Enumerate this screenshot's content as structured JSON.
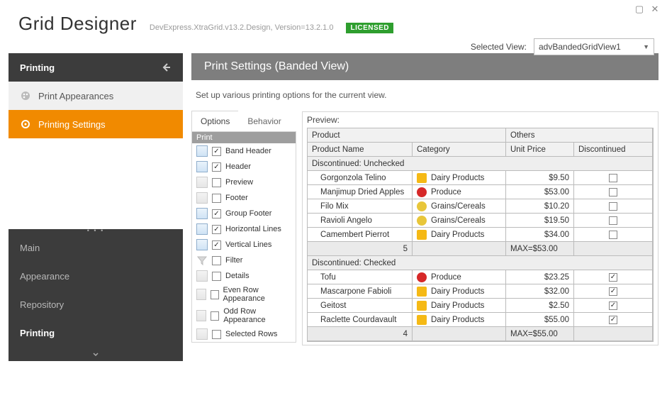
{
  "window": {
    "title": "Grid Designer",
    "assembly": "DevExpress.XtraGrid.v13.2.Design, Version=13.2.1.0",
    "license": "LICENSED"
  },
  "selected_view": {
    "label": "Selected View:",
    "value": "advBandedGridView1"
  },
  "sidebar": {
    "section": "Printing",
    "items": [
      {
        "label": "Print Appearances"
      },
      {
        "label": "Printing Settings"
      }
    ],
    "nav": [
      "Main",
      "Appearance",
      "Repository",
      "Printing"
    ],
    "active_nav": "Printing"
  },
  "panel": {
    "title": "Print Settings (Banded View)",
    "desc": "Set up various printing options for the current view."
  },
  "tabs": {
    "options": "Options",
    "behavior": "Behavior"
  },
  "options": {
    "group": "Print",
    "items": [
      {
        "label": "Band Header",
        "checked": true,
        "iconGray": false
      },
      {
        "label": "Header",
        "checked": true,
        "iconGray": false
      },
      {
        "label": "Preview",
        "checked": false,
        "iconGray": true
      },
      {
        "label": "Footer",
        "checked": false,
        "iconGray": true
      },
      {
        "label": "Group Footer",
        "checked": true,
        "iconGray": false
      },
      {
        "label": "Horizontal Lines",
        "checked": true,
        "iconGray": false
      },
      {
        "label": "Vertical Lines",
        "checked": true,
        "iconGray": false
      },
      {
        "label": "Filter",
        "checked": false,
        "iconGray": true,
        "funnel": true
      },
      {
        "label": "Details",
        "checked": false,
        "iconGray": true
      },
      {
        "label": "Even Row Appearance",
        "checked": false,
        "iconGray": true
      },
      {
        "label": "Odd Row Appearance",
        "checked": false,
        "iconGray": true
      },
      {
        "label": "Selected Rows",
        "checked": false,
        "iconGray": true
      }
    ]
  },
  "preview": {
    "label": "Preview:",
    "bands": {
      "product": "Product",
      "others": "Others"
    },
    "columns": {
      "name": "Product Name",
      "category": "Category",
      "price": "Unit Price",
      "disc": "Discontinued"
    },
    "groups": [
      {
        "title": "Discontinued: Unchecked",
        "rows": [
          {
            "name": "Gorgonzola Telino",
            "category": "Dairy Products",
            "catType": "dairy",
            "price": "$9.50",
            "disc": false
          },
          {
            "name": "Manjimup Dried Apples",
            "category": "Produce",
            "catType": "prod",
            "price": "$53.00",
            "disc": false
          },
          {
            "name": "Filo Mix",
            "category": "Grains/Cereals",
            "catType": "grain",
            "price": "$10.20",
            "disc": false
          },
          {
            "name": "Ravioli Angelo",
            "category": "Grains/Cereals",
            "catType": "grain",
            "price": "$19.50",
            "disc": false
          },
          {
            "name": "Camembert Pierrot",
            "category": "Dairy Products",
            "catType": "dairy",
            "price": "$34.00",
            "disc": false
          }
        ],
        "summary": {
          "count": "5",
          "max": "MAX=$53.00"
        }
      },
      {
        "title": "Discontinued: Checked",
        "rows": [
          {
            "name": "Tofu",
            "category": "Produce",
            "catType": "prod",
            "price": "$23.25",
            "disc": true
          },
          {
            "name": "Mascarpone Fabioli",
            "category": "Dairy Products",
            "catType": "dairy",
            "price": "$32.00",
            "disc": true
          },
          {
            "name": "Geitost",
            "category": "Dairy Products",
            "catType": "dairy",
            "price": "$2.50",
            "disc": true
          },
          {
            "name": "Raclette Courdavault",
            "category": "Dairy Products",
            "catType": "dairy",
            "price": "$55.00",
            "disc": true
          }
        ],
        "summary": {
          "count": "4",
          "max": "MAX=$55.00"
        }
      }
    ]
  }
}
